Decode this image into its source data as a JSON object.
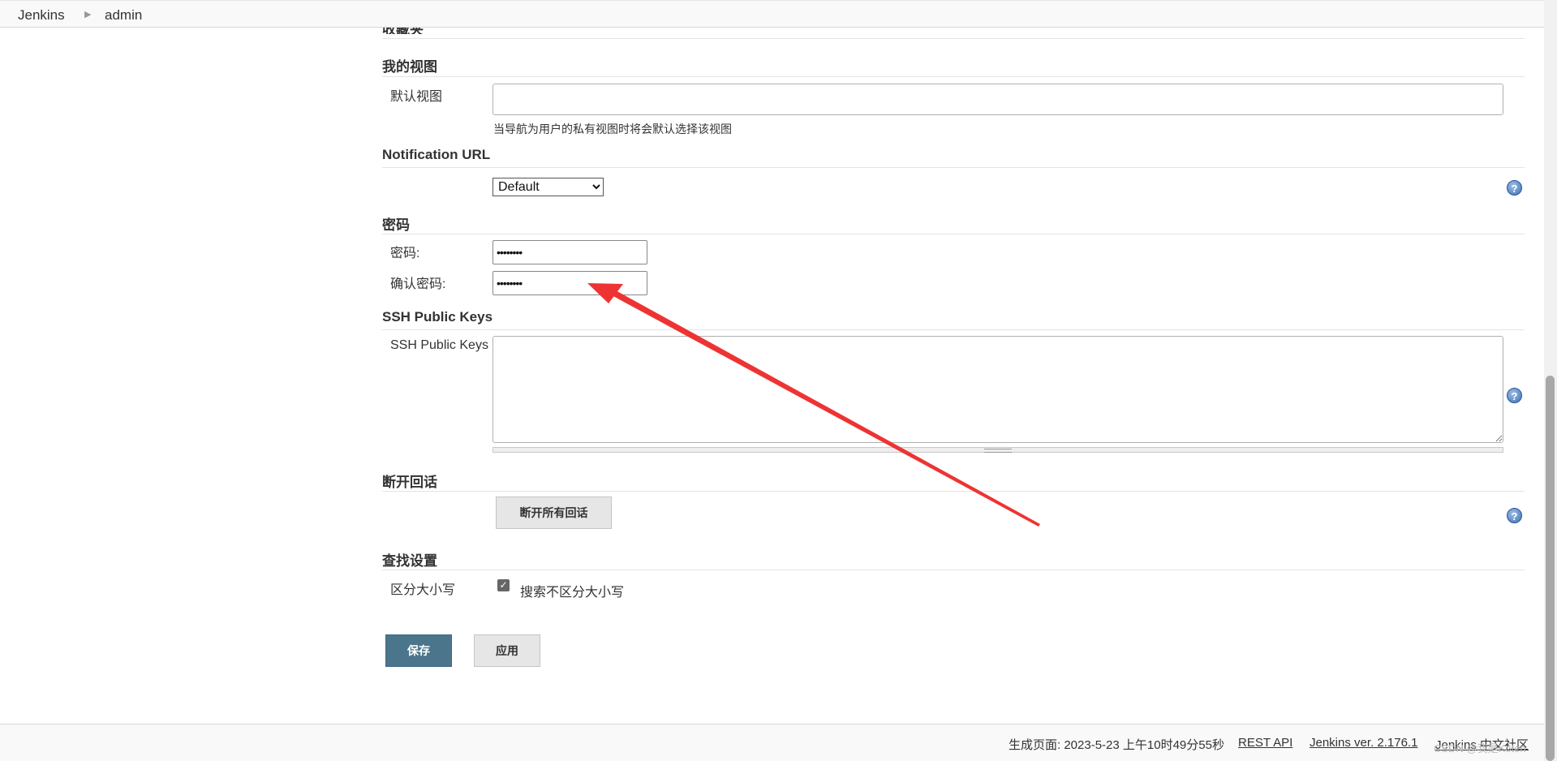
{
  "breadcrumb": {
    "home": "Jenkins",
    "user": "admin"
  },
  "partial_section": "收藏夹",
  "my_views": {
    "title": "我的视图",
    "default_view_label": "默认视图",
    "default_view_value": "",
    "hint": "当导航为用户的私有视图时将会默认选择该视图"
  },
  "notification_url": {
    "title": "Notification URL",
    "selected": "Default",
    "options": [
      "Default"
    ]
  },
  "password": {
    "title": "密码",
    "password_label": "密码:",
    "confirm_label": "确认密码:",
    "password_mask": "••••••••",
    "confirm_mask": "••••••••"
  },
  "ssh": {
    "title": "SSH Public Keys",
    "label": "SSH Public Keys",
    "value": ""
  },
  "sessions": {
    "title": "断开回话",
    "button": "断开所有回话"
  },
  "search": {
    "title": "查找设置",
    "label": "区分大小写",
    "checkbox_label": "搜索不区分大小写",
    "checked": true
  },
  "actions": {
    "save": "保存",
    "apply": "应用"
  },
  "footer": {
    "generated": "生成页面: 2023-5-23 上午10时49分55秒",
    "rest_api": "REST API",
    "version": "Jenkins ver. 2.176.1",
    "community": "Jenkins 中文社区"
  },
  "watermark": "CSDN @我是Koten",
  "colors": {
    "primary_button": "#4b758b",
    "link": "#204a87",
    "annotation_arrow": "#ee3333",
    "help_icon": "#3d6fb5"
  }
}
